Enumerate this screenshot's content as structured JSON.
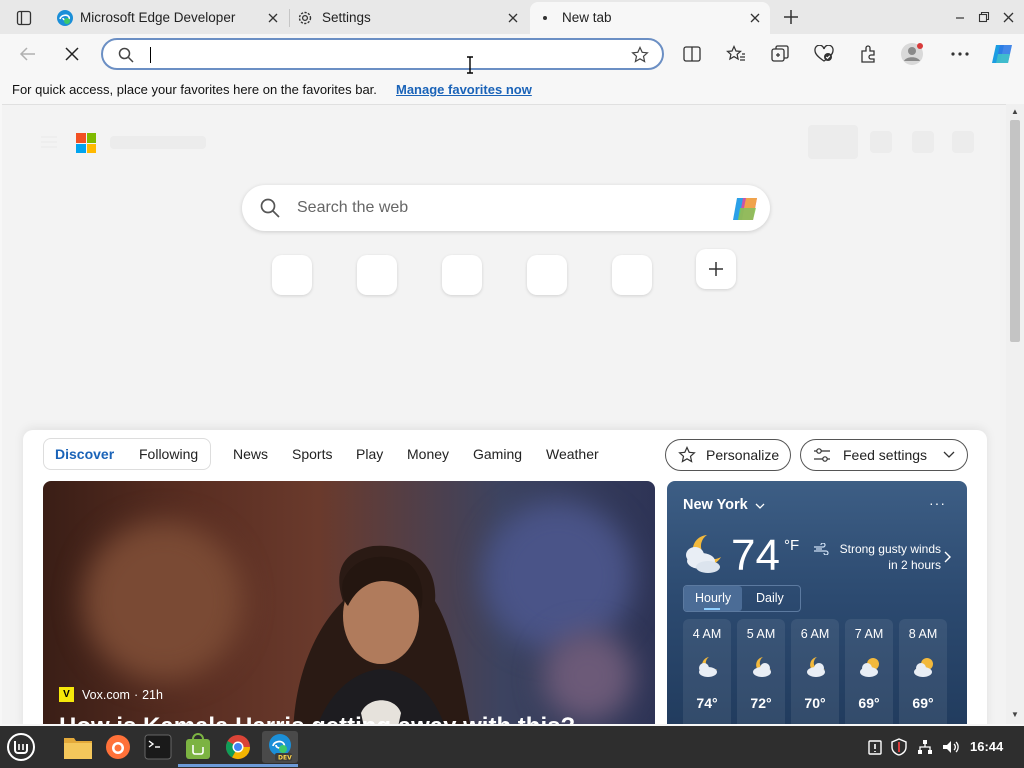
{
  "tabs": [
    {
      "label": "Microsoft Edge Developer",
      "icon": "edge-icon"
    },
    {
      "label": "Settings",
      "icon": "gear-icon"
    },
    {
      "label": "New tab",
      "icon": "dot-icon"
    }
  ],
  "address_bar": {
    "value": "",
    "placeholder": ""
  },
  "favorites_bar": {
    "message": "For quick access, place your favorites here on the favorites bar.",
    "link": "Manage favorites now"
  },
  "newtab": {
    "search_placeholder": "Search the web",
    "feed_tabs": [
      "Discover",
      "Following"
    ],
    "categories": [
      "News",
      "Sports",
      "Play",
      "Money",
      "Gaming",
      "Weather"
    ],
    "personalize": "Personalize",
    "feed_settings": "Feed settings"
  },
  "article": {
    "source": "Vox.com",
    "age": "21h",
    "headline": "How is Kamala Harris getting away with this?"
  },
  "weather": {
    "location": "New York",
    "temp": "74",
    "unit": "°F",
    "alert_line1": "Strong gusty winds",
    "alert_line2": "in 2 hours",
    "tab_hourly": "Hourly",
    "tab_daily": "Daily",
    "hourly": [
      {
        "time": "4 AM",
        "temp": "74°",
        "icon": "night-partly-cloudy-icon"
      },
      {
        "time": "5 AM",
        "temp": "72°",
        "icon": "night-partly-cloudy-icon"
      },
      {
        "time": "6 AM",
        "temp": "70°",
        "icon": "night-partly-cloudy-icon"
      },
      {
        "time": "7 AM",
        "temp": "69°",
        "icon": "partly-cloudy-icon"
      },
      {
        "time": "8 AM",
        "temp": "69°",
        "icon": "partly-cloudy-icon"
      }
    ]
  },
  "taskbar": {
    "clock": "16:44"
  },
  "colors": {
    "accent": "#1a63b8",
    "address_border": "#6b8fc4",
    "taskbar": "#2e2e2e"
  }
}
